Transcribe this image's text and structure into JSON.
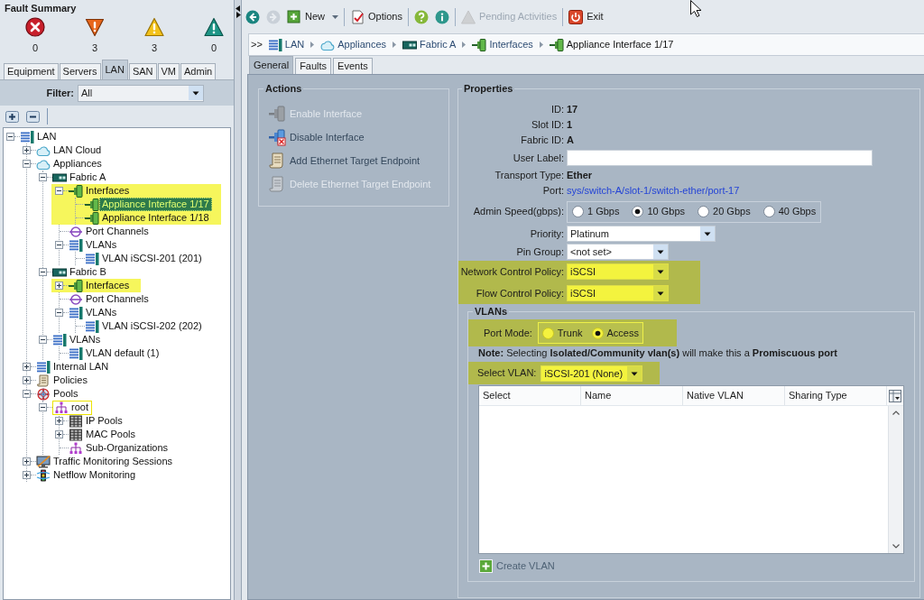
{
  "fault_summary": {
    "title": "Fault Summary",
    "items": [
      {
        "kind": "critical",
        "count": "0"
      },
      {
        "kind": "major",
        "count": "3"
      },
      {
        "kind": "minor",
        "count": "3"
      },
      {
        "kind": "warning",
        "count": "0"
      }
    ]
  },
  "nav_tabs": [
    {
      "label": "Equipment",
      "selected": false
    },
    {
      "label": "Servers",
      "selected": false
    },
    {
      "label": "LAN",
      "selected": true
    },
    {
      "label": "SAN",
      "selected": false
    },
    {
      "label": "VM",
      "selected": false
    },
    {
      "label": "Admin",
      "selected": false
    }
  ],
  "filter": {
    "label": "Filter:",
    "value": "All"
  },
  "tree": [
    {
      "label": "LAN",
      "kind": "network",
      "expanded": true,
      "selected": false,
      "highlighted": false,
      "focused": false,
      "children": [
        {
          "label": "LAN Cloud",
          "kind": "cloud",
          "expanded": false,
          "selected": false,
          "highlighted": false,
          "focused": false
        },
        {
          "label": "Appliances",
          "kind": "cloud",
          "expanded": true,
          "selected": false,
          "highlighted": false,
          "focused": false,
          "children": [
            {
              "label": "Fabric A",
              "kind": "fabric",
              "expanded": true,
              "selected": false,
              "highlighted": false,
              "focused": false,
              "children": [
                {
                  "label": "Interfaces",
                  "kind": "interface",
                  "expanded": true,
                  "selected": false,
                  "highlighted": true,
                  "focused": false,
                  "children": [
                    {
                      "label": "Appliance Interface 1/17",
                      "kind": "interface",
                      "selected": true,
                      "highlighted": false,
                      "focused": false
                    },
                    {
                      "label": "Appliance Interface 1/18",
                      "kind": "interface",
                      "selected": false,
                      "highlighted": false,
                      "focused": false
                    }
                  ]
                },
                {
                  "label": "Port Channels",
                  "kind": "ring",
                  "selected": false,
                  "highlighted": false,
                  "focused": false
                },
                {
                  "label": "VLANs",
                  "kind": "network",
                  "expanded": true,
                  "selected": false,
                  "highlighted": false,
                  "focused": false,
                  "children": [
                    {
                      "label": "VLAN iSCSI-201 (201)",
                      "kind": "network",
                      "selected": false,
                      "highlighted": false,
                      "focused": false
                    }
                  ]
                }
              ]
            },
            {
              "label": "Fabric B",
              "kind": "fabric",
              "expanded": true,
              "selected": false,
              "highlighted": false,
              "focused": false,
              "children": [
                {
                  "label": "Interfaces",
                  "kind": "interface",
                  "expanded": false,
                  "selected": false,
                  "highlighted": true,
                  "focused": false
                },
                {
                  "label": "Port Channels",
                  "kind": "ring",
                  "selected": false,
                  "highlighted": false,
                  "focused": false
                },
                {
                  "label": "VLANs",
                  "kind": "network",
                  "expanded": true,
                  "selected": false,
                  "highlighted": false,
                  "focused": false,
                  "children": [
                    {
                      "label": "VLAN iSCSI-202 (202)",
                      "kind": "network",
                      "selected": false,
                      "highlighted": false,
                      "focused": false
                    }
                  ]
                }
              ]
            },
            {
              "label": "VLANs",
              "kind": "network",
              "expanded": true,
              "selected": false,
              "highlighted": false,
              "focused": false,
              "children": [
                {
                  "label": "VLAN default (1)",
                  "kind": "network",
                  "selected": false,
                  "highlighted": false,
                  "focused": false
                }
              ]
            }
          ]
        },
        {
          "label": "Internal LAN",
          "kind": "network",
          "expanded": false,
          "selected": false,
          "highlighted": false,
          "focused": false
        },
        {
          "label": "Policies",
          "kind": "scroll",
          "expanded": false,
          "selected": false,
          "highlighted": false,
          "focused": false
        },
        {
          "label": "Pools",
          "kind": "target",
          "expanded": true,
          "selected": false,
          "highlighted": false,
          "focused": false,
          "children": [
            {
              "label": "root",
              "kind": "hierarchy",
              "expanded": true,
              "selected": false,
              "highlighted": false,
              "focused": true,
              "children": [
                {
                  "label": "IP Pools",
                  "kind": "grid",
                  "expanded": false,
                  "selected": false,
                  "highlighted": false,
                  "focused": false
                },
                {
                  "label": "MAC Pools",
                  "kind": "grid",
                  "expanded": false,
                  "selected": false,
                  "highlighted": false,
                  "focused": false
                },
                {
                  "label": "Sub-Organizations",
                  "kind": "hierarchy",
                  "selected": false,
                  "highlighted": false,
                  "focused": false
                }
              ]
            }
          ]
        },
        {
          "label": "Traffic Monitoring Sessions",
          "kind": "monitor",
          "expanded": false,
          "selected": false,
          "highlighted": false,
          "focused": false
        },
        {
          "label": "Netflow Monitoring",
          "kind": "traffic-light",
          "expanded": false,
          "selected": false,
          "highlighted": false,
          "focused": false
        }
      ]
    }
  ],
  "toolbar": {
    "groups": [
      [
        {
          "kind": "back",
          "disabled": false
        },
        {
          "kind": "forward",
          "disabled": true
        },
        {
          "kind": "new",
          "label": "New",
          "dropdown": true,
          "disabled": false
        }
      ],
      [
        {
          "kind": "options",
          "label": "Options",
          "disabled": false
        }
      ],
      [
        {
          "kind": "help",
          "disabled": false
        },
        {
          "kind": "info",
          "disabled": false
        }
      ],
      [
        {
          "kind": "pending",
          "label": "Pending Activities",
          "disabled": true
        }
      ],
      [
        {
          "kind": "exit",
          "label": "Exit",
          "disabled": false
        }
      ]
    ]
  },
  "breadcrumb": {
    "prefix": ">>",
    "items": [
      {
        "kind": "network",
        "label": "LAN",
        "current": false
      },
      {
        "kind": "cloud",
        "label": "Appliances",
        "current": false
      },
      {
        "kind": "fabric",
        "label": "Fabric A",
        "current": false
      },
      {
        "kind": "interface",
        "label": "Interfaces",
        "current": false
      },
      {
        "kind": "interface",
        "label": "Appliance Interface 1/17",
        "current": true
      }
    ]
  },
  "content_tabs": [
    {
      "label": "General",
      "selected": true
    },
    {
      "label": "Faults",
      "selected": false
    },
    {
      "label": "Events",
      "selected": false
    }
  ],
  "actions": {
    "title": "Actions",
    "items": [
      {
        "kind": "enable-interface",
        "label": "Enable Interface",
        "disabled": true
      },
      {
        "kind": "disable-interface",
        "label": "Disable Interface",
        "disabled": false
      },
      {
        "kind": "add-endpoint",
        "label": "Add Ethernet Target Endpoint",
        "disabled": false
      },
      {
        "kind": "delete-endpoint",
        "label": "Delete Ethernet Target Endpoint",
        "disabled": true
      }
    ]
  },
  "properties": {
    "title": "Properties",
    "fields": [
      {
        "kind": "value",
        "label": "ID:",
        "value": "17",
        "highlighted": false
      },
      {
        "kind": "value",
        "label": "Slot ID:",
        "value": "1",
        "highlighted": false
      },
      {
        "kind": "value",
        "label": "Fabric ID:",
        "value": "A",
        "highlighted": false
      },
      {
        "kind": "input",
        "label": "User Label:",
        "highlighted": false
      },
      {
        "kind": "value",
        "label": "Transport Type:",
        "value": "Ether",
        "highlighted": false
      },
      {
        "kind": "link",
        "label": "Port:",
        "value": "sys/switch-A/slot-1/switch-ether/port-17",
        "highlighted": false
      },
      {
        "kind": "radio",
        "label": "Admin Speed(gbps):",
        "highlighted": false,
        "options": [
          {
            "label": "1 Gbps",
            "selected": false
          },
          {
            "label": "10 Gbps",
            "selected": true
          },
          {
            "label": "20 Gbps",
            "selected": false
          },
          {
            "label": "40 Gbps",
            "selected": false
          }
        ]
      },
      {
        "kind": "select",
        "label": "Priority:",
        "value": "Platinum",
        "highlighted": false
      },
      {
        "kind": "select",
        "label": "Pin Group:",
        "value": "<not set>",
        "highlighted": false
      },
      {
        "kind": "select",
        "label": "Network Control Policy:",
        "value": "iSCSI",
        "highlighted": true
      },
      {
        "kind": "select",
        "label": "Flow Control Policy:",
        "value": "iSCSI",
        "highlighted": true
      }
    ],
    "vlans": {
      "title": "VLANs",
      "port_mode": {
        "label": "Port Mode:",
        "highlighted": true,
        "options": [
          {
            "label": "Trunk",
            "selected": false
          },
          {
            "label": "Access",
            "selected": true
          }
        ]
      },
      "note": "**Note:** Selecting **Isolated/Community vlan(s)** will make this a **Promiscuous port**",
      "select_vlan": {
        "label": "Select VLAN:",
        "value": "iSCSI-201 (None)",
        "highlighted": true
      },
      "table": {
        "columns": [
          "Select",
          "Name",
          "Native VLAN",
          "Sharing Type"
        ]
      },
      "create_button": {
        "label": "Create VLAN"
      }
    }
  }
}
